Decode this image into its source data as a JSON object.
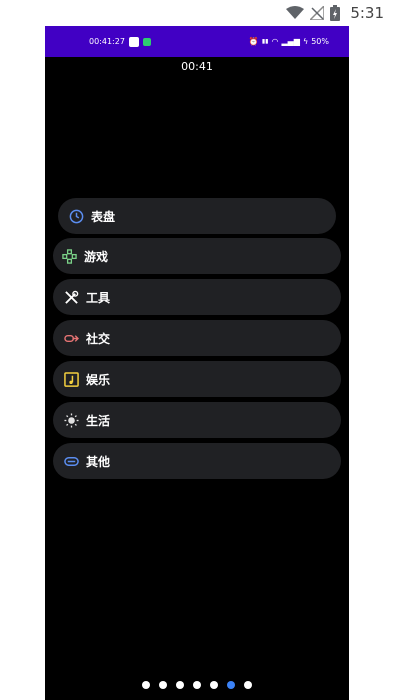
{
  "device_status": {
    "time": "5:31",
    "icons": [
      "wifi-icon",
      "no-signal-icon",
      "battery-charging-icon"
    ]
  },
  "inner_status": {
    "time": "00:41:27",
    "right_text": "50%",
    "icons": [
      "alarm-icon",
      "volte-icon",
      "wifi-icon",
      "signal-icon",
      "charging-icon"
    ]
  },
  "watch": {
    "time": "00:41"
  },
  "menu": {
    "items": [
      {
        "label": "表盘",
        "icon": "clock-icon",
        "color": "#5b8def"
      },
      {
        "label": "游戏",
        "icon": "gamepad-icon",
        "color": "#7bd389"
      },
      {
        "label": "工具",
        "icon": "tools-icon",
        "color": "#ffffff"
      },
      {
        "label": "社交",
        "icon": "link-icon",
        "color": "#e57373"
      },
      {
        "label": "娱乐",
        "icon": "music-icon",
        "color": "#f4d03f"
      },
      {
        "label": "生活",
        "icon": "sun-icon",
        "color": "#e0e0e0"
      },
      {
        "label": "其他",
        "icon": "other-icon",
        "color": "#5b8def"
      }
    ]
  },
  "pager": {
    "count": 7,
    "active_index": 5
  }
}
